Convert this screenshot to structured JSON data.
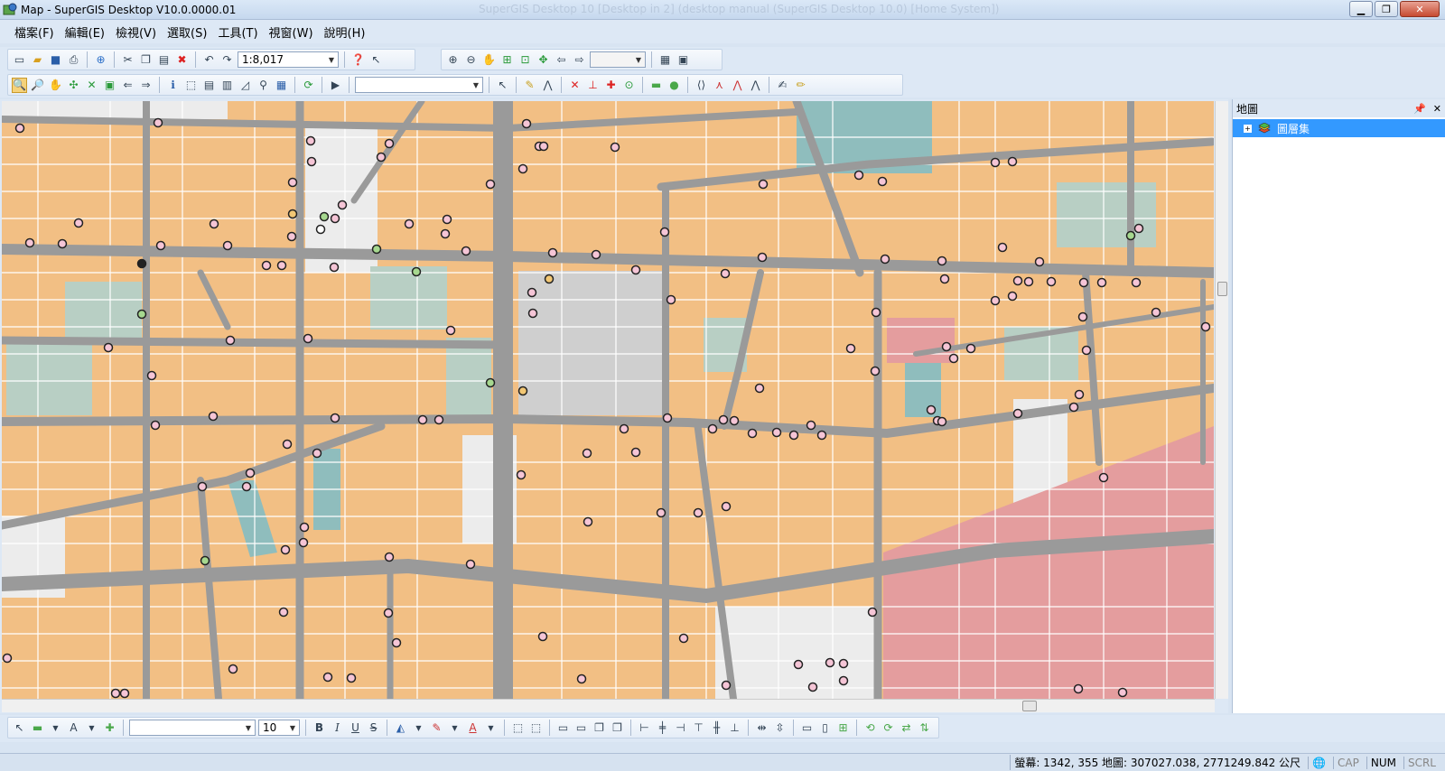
{
  "window": {
    "title": "Map - SuperGIS Desktop V10.0.0000.01",
    "ghost_title": "SuperGIS Desktop 10 [Desktop in 2] (desktop manual (SuperGIS Desktop 10.0) [Home System])",
    "min_glyph": "▁",
    "max_glyph": "❐",
    "close_glyph": "✕"
  },
  "menu": [
    "檔案(F)",
    "編輯(E)",
    "檢視(V)",
    "選取(S)",
    "工具(T)",
    "視窗(W)",
    "說明(H)"
  ],
  "toolbar": {
    "scale_value": "1:8,017",
    "zoom_combo_value": "",
    "layer_combo_value": "",
    "font_name_value": "",
    "font_size_value": "10",
    "bold_label": "B",
    "italic_label": "I",
    "underline_label": "U",
    "strike_label": "S"
  },
  "panel": {
    "title": "地圖",
    "pin_glyph": "📌",
    "close_glyph": "✕",
    "layer_label": "圖層集",
    "expander": "+"
  },
  "status": {
    "coords": "螢幕: 1342, 355  地圖: 307027.038, 2771249.842 公尺",
    "cap": "CAP",
    "num": "NUM",
    "scrl": "SCRL"
  },
  "colors": {
    "parcel": "#f2bf84",
    "road": "#9a9a9a",
    "green": "#b8cfc4",
    "teal": "#8fbdbd",
    "gray": "#c8c8c8",
    "pink": "#e49d9e",
    "poi_pink": "#f5c5d6",
    "poi_green": "#a6d88f",
    "poi_orange": "#f2c774"
  }
}
